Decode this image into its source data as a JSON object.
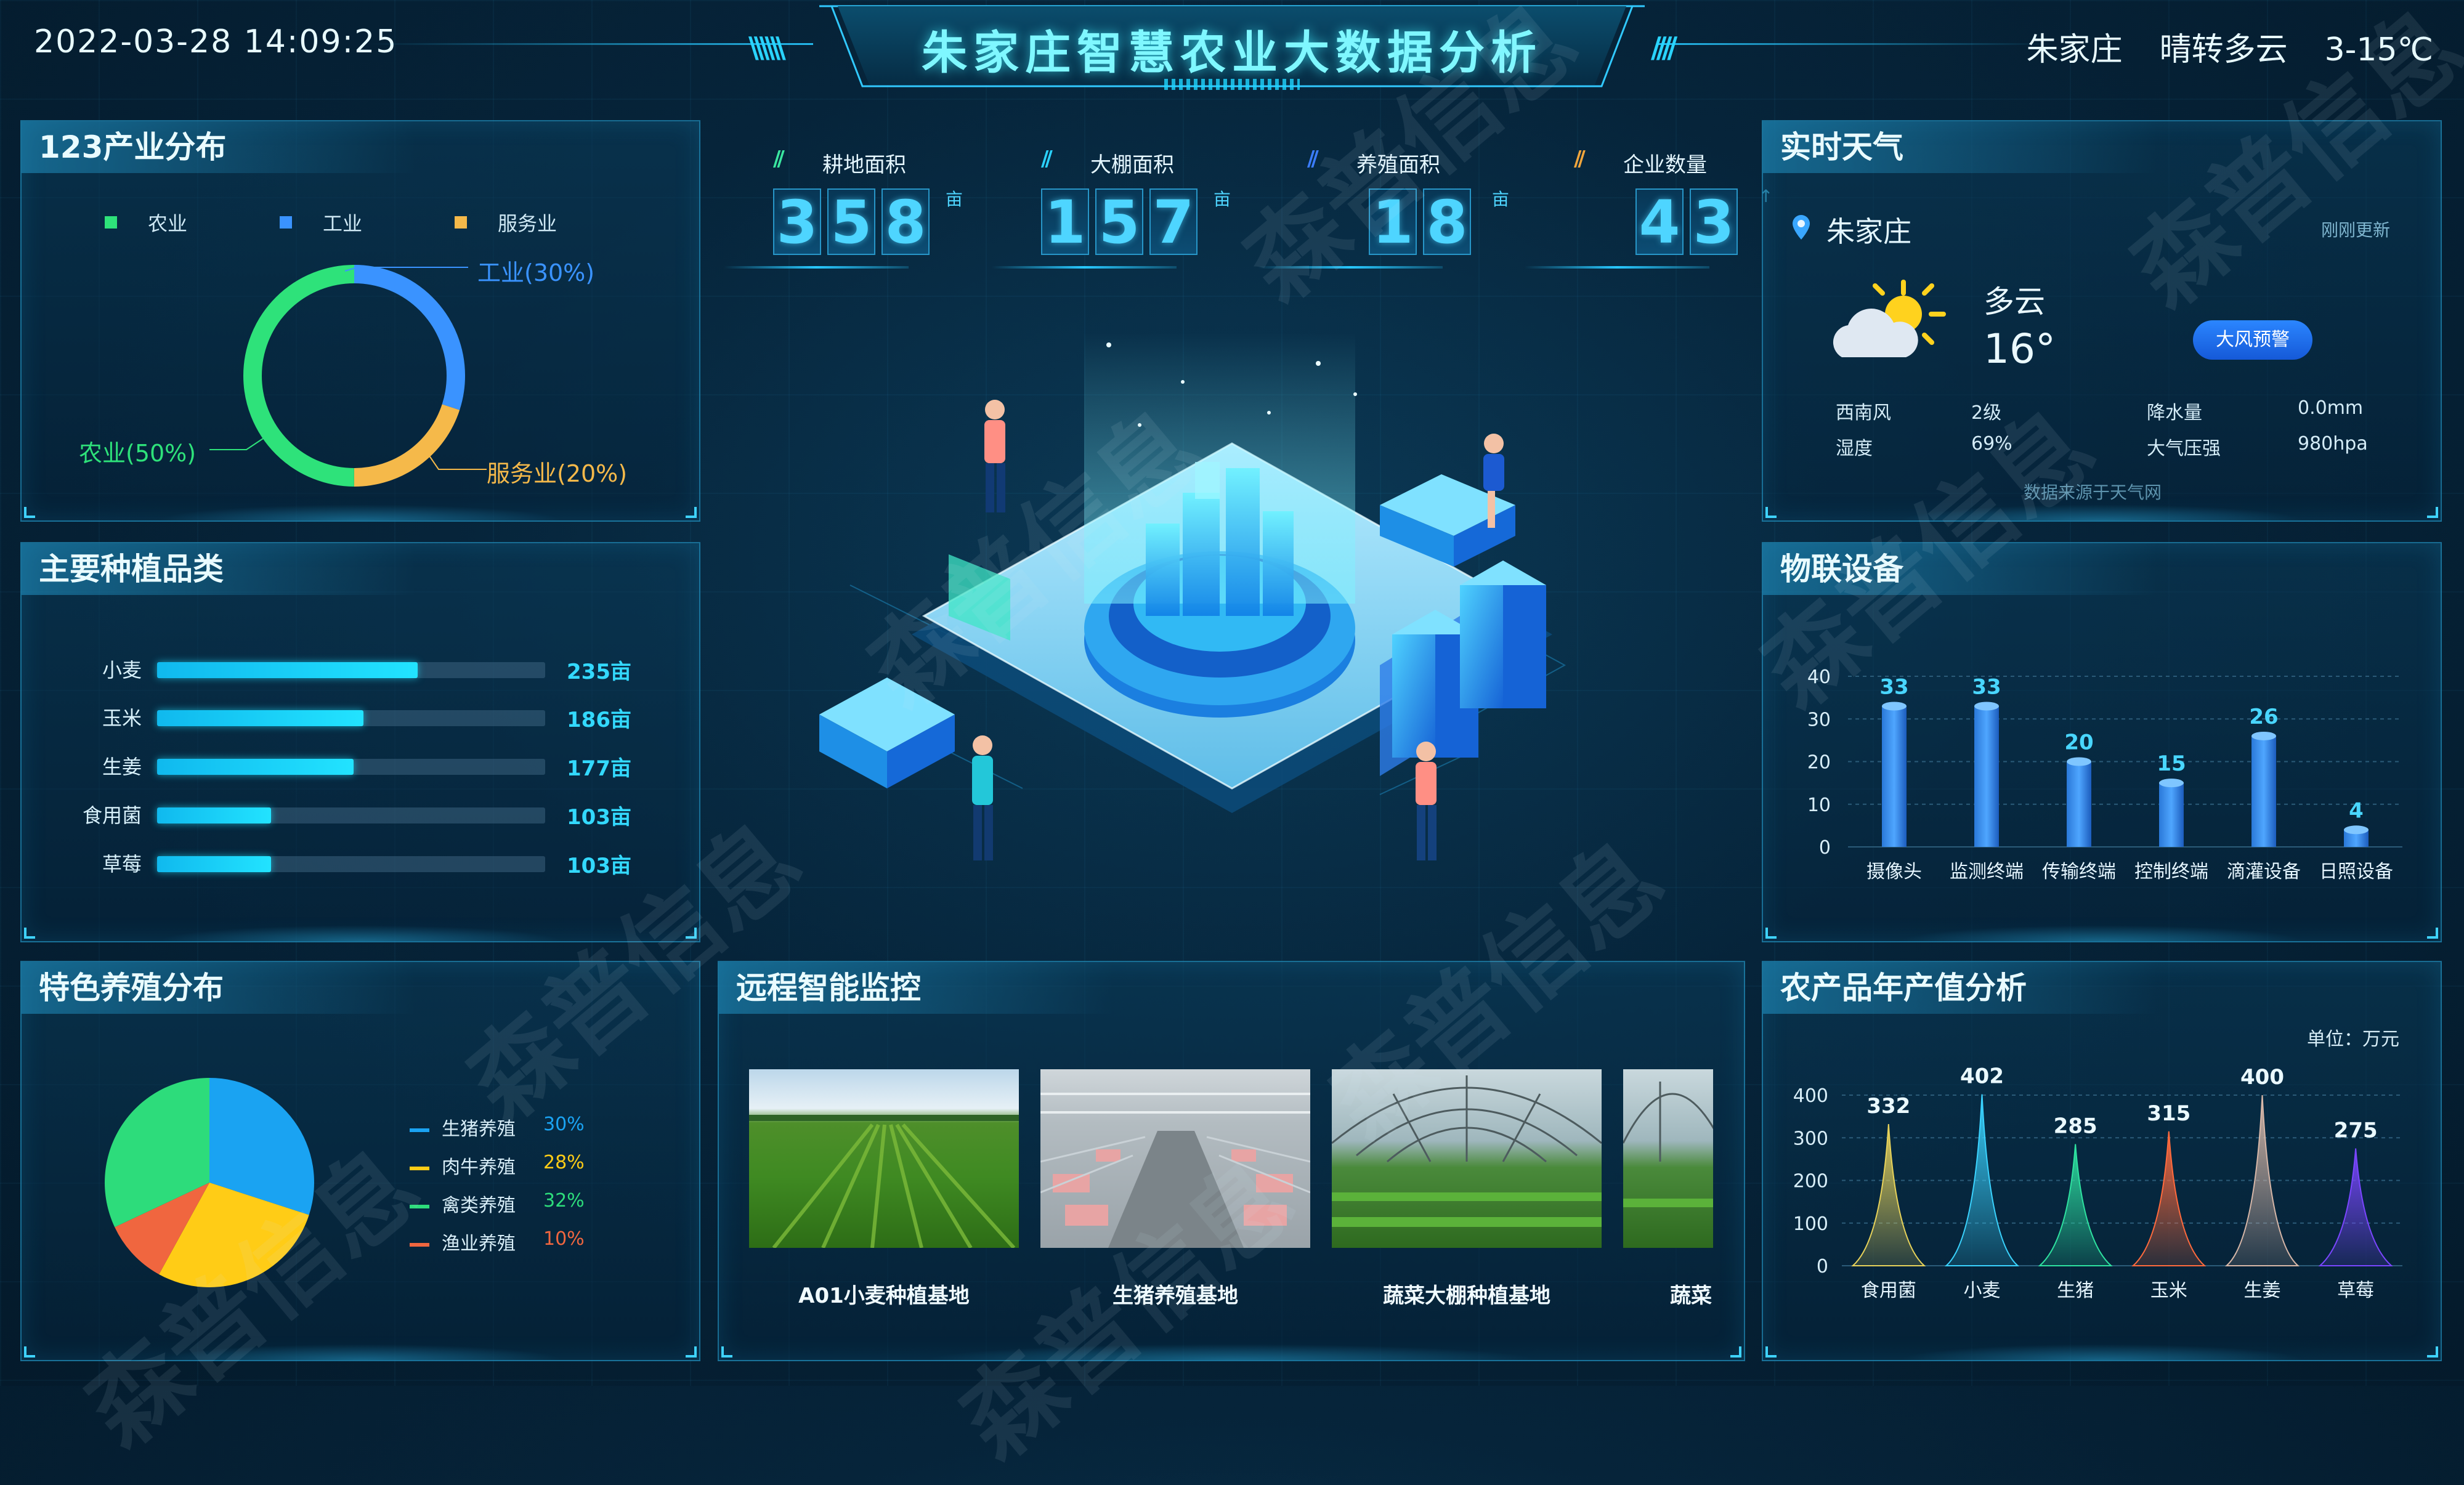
{
  "header": {
    "datetime": "2022-03-28  14:09:25",
    "title": "朱家庄智慧农业大数据分析",
    "location": "朱家庄",
    "weather": "晴转多云",
    "temperature": "3-15℃"
  },
  "industry": {
    "title": "123产业分布",
    "legend": [
      "农业",
      "工业",
      "服务业"
    ],
    "labels": {
      "industry": "工业(30%)",
      "service": "服务业(20%)",
      "agriculture": "农业(50%)"
    },
    "colors": {
      "agriculture": "#2ee27a",
      "industry": "#3a93ff",
      "service": "#f5b94a"
    }
  },
  "crops": {
    "title": "主要种植品类",
    "max": 350,
    "items": [
      {
        "name": "小麦",
        "value": 235,
        "label": "235亩"
      },
      {
        "name": "玉米",
        "value": 186,
        "label": "186亩"
      },
      {
        "name": "生姜",
        "value": 177,
        "label": "177亩"
      },
      {
        "name": "食用菌",
        "value": 103,
        "label": "103亩"
      },
      {
        "name": "草莓",
        "value": 103,
        "label": "103亩"
      }
    ]
  },
  "stats": [
    {
      "label": "耕地面积",
      "digits": [
        "3",
        "5",
        "8"
      ],
      "unit": "亩",
      "slash_color": "#3ae6a0"
    },
    {
      "label": "大棚面积",
      "digits": [
        "1",
        "5",
        "7"
      ],
      "unit": "亩",
      "slash_color": "#2bd2ff"
    },
    {
      "label": "养殖面积",
      "digits": [
        "1",
        "8"
      ],
      "unit": "亩",
      "slash_color": "#3b7dff"
    },
    {
      "label": "企业数量",
      "digits": [
        "4",
        "3"
      ],
      "unit": "↑",
      "slash_color": "#f0a53c"
    }
  ],
  "weather_panel": {
    "title": "实时天气",
    "location": "朱家庄",
    "updated": "刚刚更新",
    "condition": "多云",
    "temp": "16°",
    "warning": "大风预警",
    "wind_dir": "西南风",
    "wind_level": "2级",
    "rain_label": "降水量",
    "rain_value": "0.0mm",
    "humidity_label": "湿度",
    "humidity_value": "69%",
    "pressure_label": "大气压强",
    "pressure_value": "980hpa",
    "source": "数据来源于天气网"
  },
  "iot": {
    "title": "物联设备",
    "chart_data": {
      "type": "bar",
      "categories": [
        "摄像头",
        "监测终端",
        "传输终端",
        "控制终端",
        "滴灌设备",
        "日照设备"
      ],
      "values": [
        33,
        33,
        20,
        15,
        26,
        4
      ],
      "ylim": [
        0,
        40
      ],
      "yticks": [
        0,
        10,
        20,
        30,
        40
      ]
    }
  },
  "breeding": {
    "title": "特色养殖分布",
    "chart_data": {
      "type": "pie",
      "categories": [
        "生猪养殖",
        "肉牛养殖",
        "禽类养殖",
        "渔业养殖"
      ],
      "values": [
        30,
        28,
        32,
        10
      ],
      "labels": [
        "30%",
        "28%",
        "32%",
        "10%"
      ],
      "colors": [
        "#1aa3f2",
        "#ffcc16",
        "#2ddc7b",
        "#f0663f"
      ]
    }
  },
  "monitor": {
    "title": "远程智能监控",
    "cams": [
      "A01小麦种植基地",
      "生猪养殖基地",
      "蔬菜大棚种植基地",
      "蔬菜"
    ]
  },
  "output_value": {
    "title": "农产品年产值分析",
    "unit": "单位：万元",
    "chart_data": {
      "type": "bar",
      "categories": [
        "食用菌",
        "小麦",
        "生猪",
        "玉米",
        "生姜",
        "草莓"
      ],
      "values": [
        332,
        402,
        285,
        315,
        400,
        275
      ],
      "ylim": [
        0,
        400
      ],
      "yticks": [
        0,
        100,
        200,
        300,
        400
      ],
      "colors": [
        "#e7d25a",
        "#3ad3ff",
        "#2ee2a0",
        "#ff6a3d",
        "#d7b7a8",
        "#7a46ff"
      ]
    }
  },
  "watermark": "森普信息"
}
